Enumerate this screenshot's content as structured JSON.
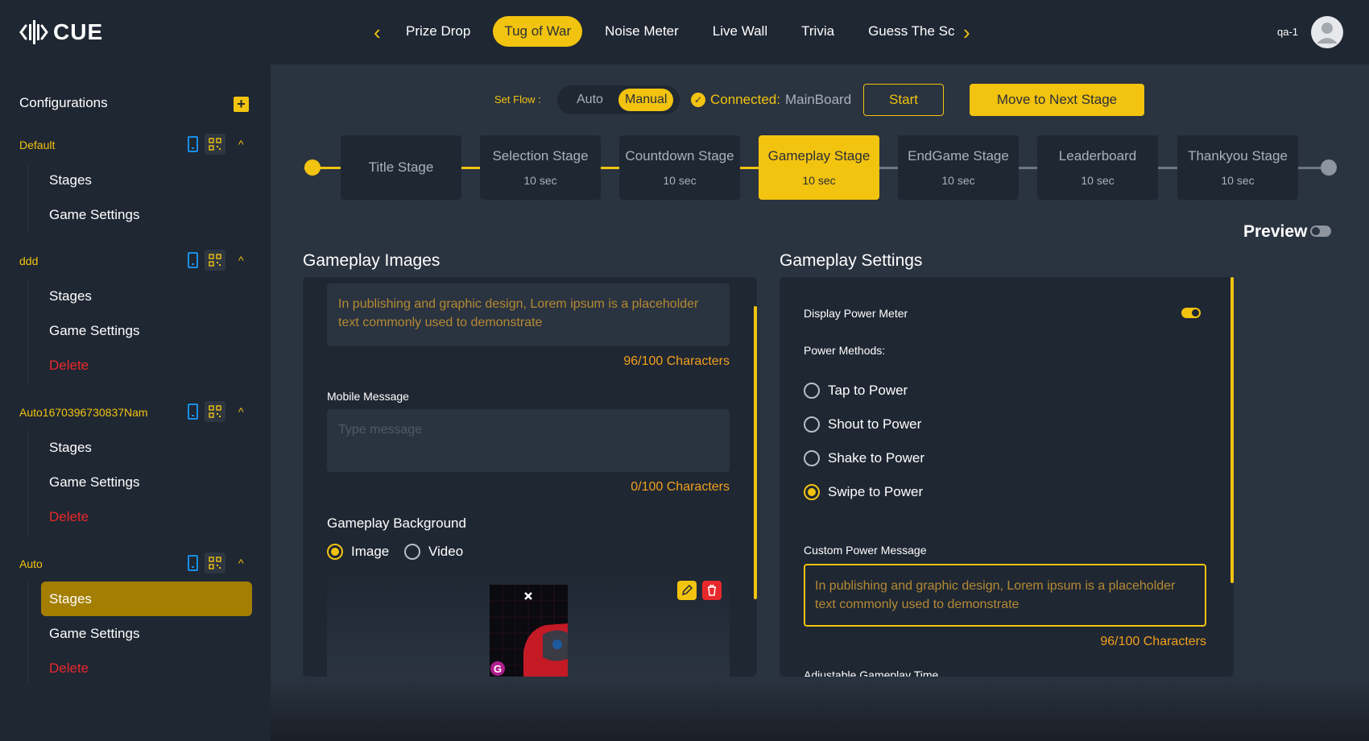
{
  "app": {
    "brand": "CUE",
    "username": "qa-1"
  },
  "game_tabs": [
    {
      "label": "Prize Drop"
    },
    {
      "label": "Tug of War",
      "active": true
    },
    {
      "label": "Noise Meter"
    },
    {
      "label": "Live Wall"
    },
    {
      "label": "Trivia"
    },
    {
      "label": "Guess The Sc"
    }
  ],
  "sidebar": {
    "heading": "Configurations",
    "add_symbol": "+",
    "configs": [
      {
        "name": "Default",
        "items": [
          "Stages",
          "Game Settings"
        ]
      },
      {
        "name": "ddd",
        "items": [
          "Stages",
          "Game Settings",
          "Delete"
        ]
      },
      {
        "name": "Auto1670396730837Nam",
        "items": [
          "Stages",
          "Game Settings",
          "Delete"
        ]
      },
      {
        "name": "Auto",
        "items": [
          "Stages",
          "Game Settings",
          "Delete"
        ],
        "active_item": "Stages"
      }
    ]
  },
  "flow": {
    "label": "Set Flow :",
    "options": [
      "Auto",
      "Manual"
    ],
    "selected": "Manual",
    "connected_label": "Connected:",
    "connected_value": "MainBoard",
    "start_label": "Start",
    "next_label": "Move to Next Stage"
  },
  "stages": [
    {
      "title": "Title Stage",
      "time": ""
    },
    {
      "title": "Selection Stage",
      "time": "10 sec"
    },
    {
      "title": "Countdown Stage",
      "time": "10 sec"
    },
    {
      "title": "Gameplay Stage",
      "time": "10 sec",
      "active": true
    },
    {
      "title": "EndGame Stage",
      "time": "10 sec"
    },
    {
      "title": "Leaderboard",
      "time": "10 sec"
    },
    {
      "title": "Thankyou Stage",
      "time": "10 sec"
    }
  ],
  "preview": {
    "label": "Preview",
    "enabled": false
  },
  "gameplay_images": {
    "title": "Gameplay Images",
    "message_text": "In publishing and graphic design, Lorem ipsum is a placeholder text commonly used to demonstrate",
    "message_count": "96/100 Characters",
    "mobile_label": "Mobile Message",
    "mobile_placeholder": "Type message",
    "mobile_count": "0/100 Characters",
    "background_label": "Gameplay Background",
    "background_options": [
      "Image",
      "Video"
    ],
    "background_selected": "Image"
  },
  "gameplay_settings": {
    "title": "Gameplay Settings",
    "power_meter_label": "Display Power Meter",
    "power_meter_enabled": true,
    "methods_label": "Power Methods:",
    "methods": [
      "Tap to Power",
      "Shout to Power",
      "Shake to Power",
      "Swipe to Power"
    ],
    "method_selected": "Swipe to Power",
    "custom_label": "Custom Power Message",
    "custom_text": "In publishing and graphic design, Lorem ipsum is a placeholder text commonly used to demonstrate",
    "custom_count": "96/100 Characters",
    "adjustable_label": "Adjustable Gameplay Time"
  },
  "colors": {
    "accent": "#f2c30f",
    "danger": "#e8292b",
    "phone_icon": "#1a8fe6"
  }
}
